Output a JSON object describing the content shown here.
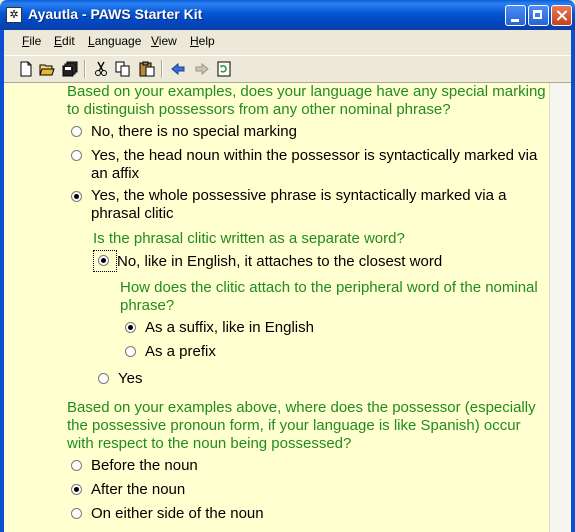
{
  "window": {
    "title": "Ayautla - PAWS Starter Kit"
  },
  "menu": [
    {
      "label": "File",
      "key": "F",
      "rest": "ile"
    },
    {
      "label": "Edit",
      "key": "E",
      "rest": "dit"
    },
    {
      "label": "Language",
      "key": "L",
      "rest": "anguage"
    },
    {
      "label": "View",
      "key": "V",
      "rest": "iew"
    },
    {
      "label": "Help",
      "key": "H",
      "rest": "elp"
    }
  ],
  "toolbar": [
    "new-icon",
    "open-icon",
    "save-all-icon",
    "cut-icon",
    "copy-icon",
    "paste-icon",
    "back-icon",
    "forward-icon",
    "refresh-icon"
  ],
  "q1": {
    "text": "Based on your examples, does your language have any special marking to distinguish possessors from any other nominal phrase?",
    "options": [
      "No, there is no special marking",
      "Yes, the head noun within the possessor is syntactically marked via an affix",
      "Yes, the whole possessive phrase is syntactically marked via a phrasal clitic"
    ],
    "selected": 2
  },
  "q1a": {
    "text": "Is the phrasal clitic written as a separate word?",
    "options": [
      "No, like in English, it attaches to the closest word",
      "Yes"
    ],
    "selected": 0
  },
  "q1b": {
    "text": "How does the clitic attach to the peripheral word of the nominal phrase?",
    "options": [
      "As a suffix, like in English",
      "As a prefix"
    ],
    "selected": 0
  },
  "q2": {
    "text": "Based on your examples above, where does the possessor (especially the possessive pronoun form, if your language is like Spanish) occur with respect to the noun being possessed?",
    "options": [
      "Before the noun",
      "After the noun",
      "On either side of the noun"
    ],
    "selected": 1
  },
  "colors": {
    "question": "#228b22",
    "background": "#ffffd0",
    "titlebar": "#0a5fd8"
  }
}
